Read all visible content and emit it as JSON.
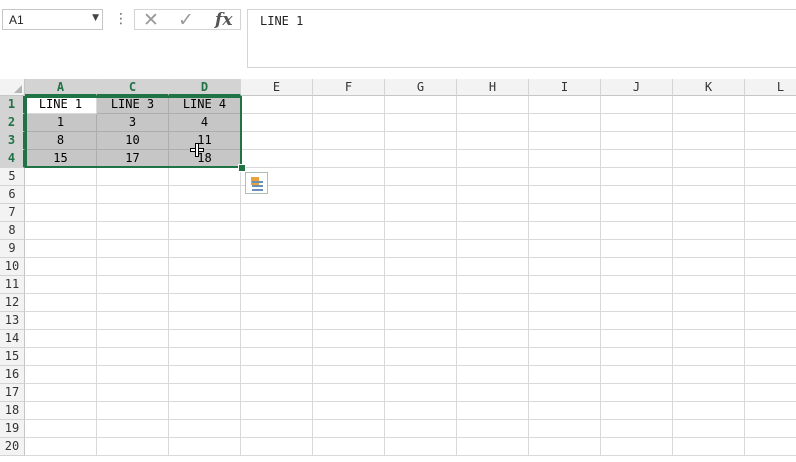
{
  "formula_bar": {
    "name_box": "A1",
    "menu_glyph": "⋮",
    "cancel_glyph": "✕",
    "enter_glyph": "✓",
    "fx_label": "fx",
    "content": "LINE 1"
  },
  "columns": [
    "A",
    "C",
    "D",
    "E",
    "F",
    "G",
    "H",
    "I",
    "J",
    "K",
    "L"
  ],
  "rows": [
    "1",
    "2",
    "3",
    "4",
    "5",
    "6",
    "7",
    "8",
    "9",
    "10",
    "11",
    "12",
    "13",
    "14",
    "15",
    "16",
    "17",
    "18",
    "19",
    "20"
  ],
  "cells": {
    "r1": [
      "LINE 1",
      "LINE 3",
      "LINE 4"
    ],
    "r2": [
      "1",
      "3",
      "4"
    ],
    "r3": [
      "8",
      "10",
      "11"
    ],
    "r4": [
      "15",
      "17",
      "18"
    ]
  },
  "colors": {
    "selection": "#217346",
    "shade": "#c6c6c6"
  }
}
